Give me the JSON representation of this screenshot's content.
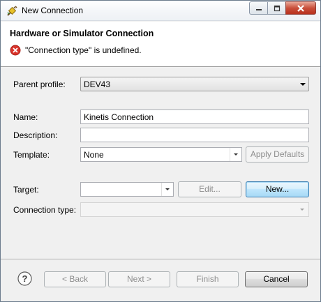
{
  "window": {
    "title": "New Connection",
    "icon": "connection-plug-icon"
  },
  "banner": {
    "title": "Hardware or Simulator Connection",
    "message": "\"Connection type\" is undefined.",
    "message_icon": "error-icon"
  },
  "form": {
    "parent_profile": {
      "label": "Parent profile:",
      "value": "DEV43"
    },
    "name": {
      "label": "Name:",
      "value": "Kinetis Connection"
    },
    "description": {
      "label": "Description:",
      "value": ""
    },
    "template": {
      "label": "Template:",
      "value": "None",
      "apply_defaults_label": "Apply Defaults"
    },
    "target": {
      "label": "Target:",
      "value": "",
      "edit_label": "Edit...",
      "new_label": "New..."
    },
    "connection_type": {
      "label": "Connection type:",
      "value": ""
    }
  },
  "footer": {
    "help_icon": "help-icon",
    "back_label": "< Back",
    "next_label": "Next >",
    "finish_label": "Finish",
    "cancel_label": "Cancel"
  },
  "colors": {
    "error_red": "#d9342b",
    "default_button_border": "#3c7fb1",
    "close_button_red": "#c9503c"
  }
}
